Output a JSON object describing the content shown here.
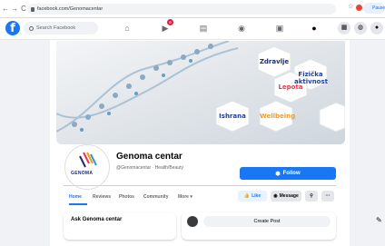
{
  "browser": {
    "url": "facebook.com/Genomacentar",
    "profile_label": "Pause"
  },
  "fb": {
    "search_placeholder": "Search Facebook",
    "notif_count": "6"
  },
  "cover": {
    "words": [
      "Zdravlje",
      "Fizička aktivnost",
      "Lepota",
      "Ishrana",
      "Wellbeing"
    ],
    "colors": {
      "dark": "#1f2e6e",
      "accent": "#e8384f",
      "orange": "#f59a23"
    }
  },
  "page": {
    "logo_text": "GENOMA",
    "name": "Genoma centar",
    "subtitle": "@Genomacentar · Health/Beauty",
    "follow_label": "Follow"
  },
  "tabs": [
    "Home",
    "Reviews",
    "Photos",
    "Community",
    "More ▾"
  ],
  "actions": {
    "like": "Like",
    "message": "Message"
  },
  "lower": {
    "ask_title": "Ask Genoma centar",
    "create_post": "Create Post"
  },
  "accent": "#1877f2"
}
